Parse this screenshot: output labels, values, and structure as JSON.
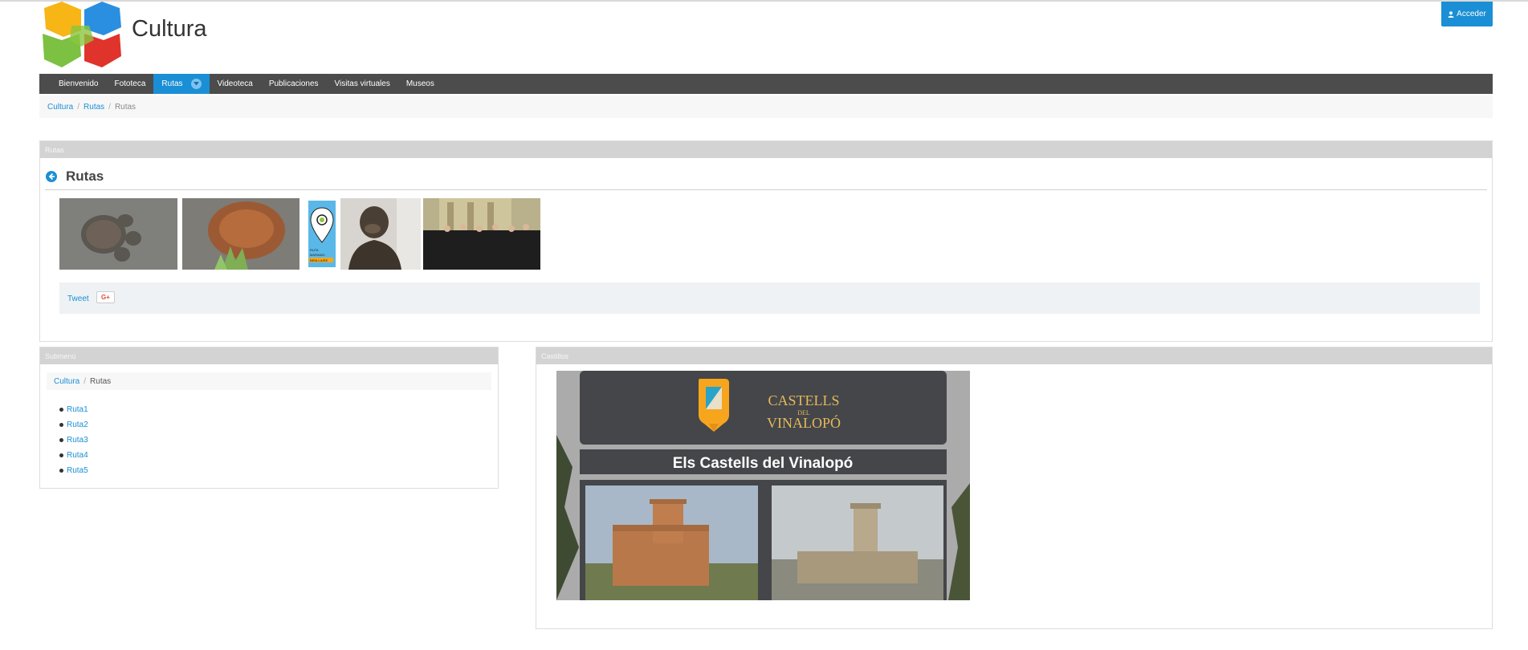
{
  "site": {
    "title": "Cultura"
  },
  "header": {
    "login_label": "Acceder"
  },
  "nav": {
    "items": [
      {
        "label": "Bienvenido"
      },
      {
        "label": "Fototeca"
      },
      {
        "label": "Rutas",
        "active": true
      },
      {
        "label": "Videoteca"
      },
      {
        "label": "Publicaciones"
      },
      {
        "label": "Visitas virtuales"
      },
      {
        "label": "Museos"
      }
    ]
  },
  "breadcrumb": {
    "items": [
      "Cultura",
      "Rutas",
      "Rutas"
    ],
    "separator": "/"
  },
  "rutas_panel": {
    "header": "Rutas",
    "title": "Rutas",
    "badge_lines": [
      "RUTA",
      "MARIANO",
      "BENLLIURE"
    ],
    "share": {
      "tweet": "Tweet",
      "gplus": "G+"
    }
  },
  "submenu_panel": {
    "header": "Submenú",
    "breadcrumb": [
      "Cultura",
      "Rutas"
    ],
    "items": [
      "Ruta1",
      "Ruta2",
      "Ruta3",
      "Ruta4",
      "Ruta5"
    ]
  },
  "castillos_panel": {
    "header": "Castillos",
    "banner_brand_top": "CASTELLS",
    "banner_brand_mid": "DEL",
    "banner_brand_bottom": "VINALOPÓ",
    "banner_title": "Els Castells del Vinalopó"
  },
  "colors": {
    "accent": "#1a8fd5",
    "navbar": "#4c4c4c",
    "panel_header": "#d3d3d3"
  }
}
